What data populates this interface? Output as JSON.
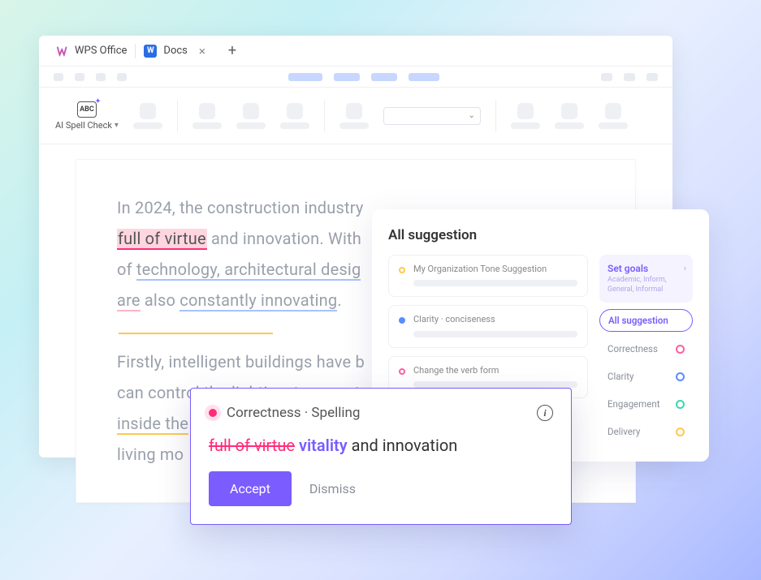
{
  "tabs": {
    "app_name": "WPS Office",
    "doc_tab": "Docs"
  },
  "toolbar": {
    "spellcheck_label": "AI Spell Check",
    "abc": "ABC"
  },
  "document": {
    "l1a": "In 2024, the construction industry",
    "l1_hl": "full of virtue",
    "l1b": " and innovation. With",
    "l2a": "of ",
    "l2_blue": "technology, architectural desig",
    "l3_pink": "are",
    "l3_mid": " also ",
    "l3_blue": "constantly innovating",
    "l3_end": ".",
    "l4": "Firstly, intelligent buildings have b",
    "l5": "can control the lighting, temperat",
    "l6a": "inside the",
    "l7": "living mo"
  },
  "suggestions": {
    "title": "All suggestion",
    "cards": [
      {
        "label": "My Organization Tone Suggestion"
      },
      {
        "label": "Clarity · conciseness"
      },
      {
        "label": "Change the verb form"
      }
    ],
    "goals": {
      "title": "Set goals",
      "sub": "Academic, Inform, General, Informal"
    },
    "filters": {
      "all": "All suggestion",
      "correctness": "Correctness",
      "clarity": "Clarity",
      "engagement": "Engagement",
      "delivery": "Delivery"
    }
  },
  "popup": {
    "category": "Correctness · Spelling",
    "strike": "full of virtue",
    "replacement": "vitality",
    "tail": " and innovation",
    "accept": "Accept",
    "dismiss": "Dismiss"
  }
}
